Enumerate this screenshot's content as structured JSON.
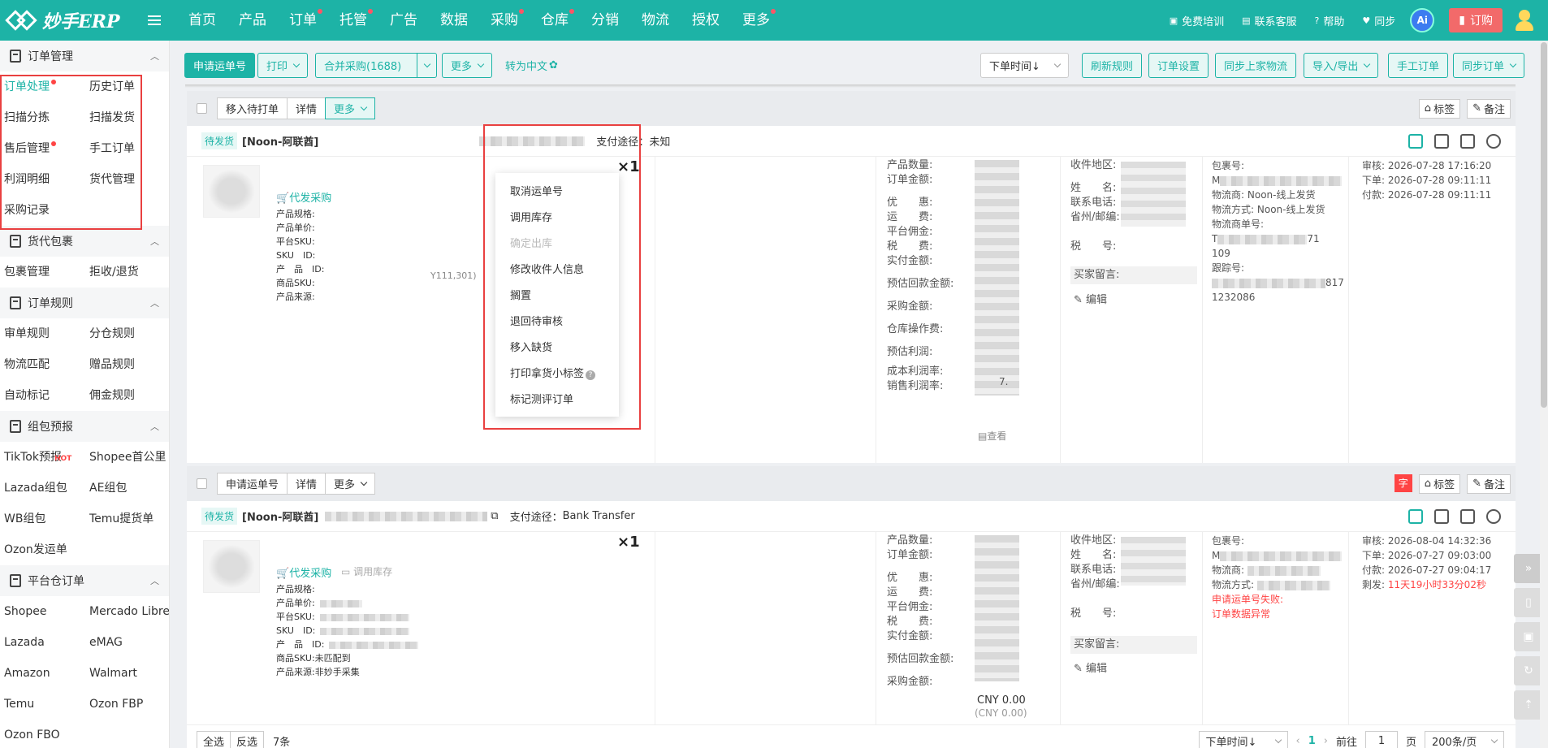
{
  "app": {
    "logo_text": "妙手ERP"
  },
  "topnav": {
    "items": [
      {
        "label": "首页",
        "dot": false
      },
      {
        "label": "产品",
        "dot": false
      },
      {
        "label": "订单",
        "dot": true
      },
      {
        "label": "托管",
        "dot": true
      },
      {
        "label": "广告",
        "dot": false
      },
      {
        "label": "数据",
        "dot": false
      },
      {
        "label": "采购",
        "dot": true
      },
      {
        "label": "仓库",
        "dot": true
      },
      {
        "label": "分销",
        "dot": false
      },
      {
        "label": "物流",
        "dot": false
      },
      {
        "label": "授权",
        "dot": false
      },
      {
        "label": "更多",
        "dot": true
      }
    ],
    "right": {
      "training": "免费培训",
      "service": "联系客服",
      "help": "帮助",
      "sync": "同步",
      "ai": "Ai",
      "order": "订购"
    }
  },
  "sidebar": {
    "sections": [
      {
        "title": "订单管理",
        "items": [
          "订单处理",
          "历史订单",
          "扫描分拣",
          "扫描发货",
          "售后管理",
          "手工订单",
          "利润明细",
          "货代管理",
          "采购记录"
        ]
      },
      {
        "title": "货代包裹",
        "items": [
          "包裹管理",
          "拒收/退货"
        ]
      },
      {
        "title": "订单规则",
        "items": [
          "审单规则",
          "分仓规则",
          "物流匹配",
          "赠品规则",
          "自动标记",
          "佣金规则"
        ]
      },
      {
        "title": "组包预报",
        "items": [
          "TikTok预报",
          "Shopee首公里",
          "Lazada组包",
          "AE组包",
          "WB组包",
          "Temu提货单",
          "Ozon发运单"
        ]
      },
      {
        "title": "平台仓订单",
        "items": [
          "Shopee",
          "Mercado Libre",
          "Lazada",
          "eMAG",
          "Amazon",
          "Walmart",
          "Temu",
          "Ozon FBP",
          "Ozon FBO"
        ]
      }
    ],
    "hot_badge": "HOT"
  },
  "toolbar": {
    "apply_waybill": "申请运单号",
    "print": "打印",
    "merge_purchase": "合并采购(1688)",
    "more": "更多",
    "to_chinese": "转为中文",
    "sort": "下单时间↓",
    "refresh_rules": "刷新规则",
    "order_settings": "订单设置",
    "sync_logistics": "同步上家物流",
    "import_export": "导入/导出",
    "manual_order": "手工订单",
    "sync_orders": "同步订单"
  },
  "order1": {
    "btn_move": "移入待打单",
    "btn_detail": "详情",
    "btn_more": "更多",
    "tag": "标签",
    "note": "备注",
    "status": "待发货",
    "shop": "[Noon-阿联酋]",
    "pay_label": "支付途径：",
    "pay_value": "未知",
    "qty": "×1",
    "purchase": "代发采购",
    "product_labels": [
      "产品规格:",
      "产品单价:",
      "平台SKU:",
      "SKU　ID:",
      "产　品　ID:",
      "商品SKU:",
      "产品来源:"
    ],
    "sku_tail": "Y111,301)",
    "fin_labels": [
      "产品数量:",
      "订单金额:",
      "优　　惠:",
      "运　　费:",
      "平台佣金:",
      "税　　费:",
      "实付金额:",
      "预估回款金额:",
      "采购金额:",
      "仓库操作费:",
      "预估利润:",
      "成本利润率:",
      "销售利润率:"
    ],
    "fin_tail": "7.",
    "view": "查看",
    "rcv_labels": [
      "收件地区:",
      "姓　　名:",
      "联系电话:",
      "省州/邮编:",
      "税　　号:"
    ],
    "buyer_msg": "买家留言:",
    "edit": "编辑",
    "pkg": {
      "pkg_no": "包裹号:",
      "prefix_m": "M",
      "carrier_label": "物流商:",
      "carrier": "Noon-线上发货",
      "method_label": "物流方式:",
      "method": "Noon-线上发货",
      "track_label": "物流商单号:",
      "track_a": "71",
      "track_b": "109",
      "track_c": "跟踪号:",
      "track_d": "817",
      "track_e": "1232086"
    },
    "times": {
      "audit": "审核: 2026-07-28 17:16:20",
      "order": "下单: 2026-07-28 09:11:11",
      "paid": "付款: 2026-07-28 09:11:11"
    }
  },
  "dropdown": {
    "items": [
      {
        "label": "取消运单号",
        "disabled": false
      },
      {
        "label": "调用库存",
        "disabled": false
      },
      {
        "label": "确定出库",
        "disabled": true
      },
      {
        "label": "修改收件人信息",
        "disabled": false
      },
      {
        "label": "搁置",
        "disabled": false
      },
      {
        "label": "退回待审核",
        "disabled": false
      },
      {
        "label": "移入缺货",
        "disabled": false
      },
      {
        "label": "打印拿货小标签",
        "disabled": false
      },
      {
        "label": "标记测评订单",
        "disabled": false
      }
    ]
  },
  "order2": {
    "btn_apply": "申请运单号",
    "btn_detail": "详情",
    "btn_more": "更多",
    "zi": "字",
    "tag": "标签",
    "note": "备注",
    "status": "待发货",
    "shop": "[Noon-阿联酋]",
    "pay_label": "支付途径：",
    "pay_value": "Bank Transfer",
    "qty": "×1",
    "purchase": "代发采购",
    "stock": "调用库存",
    "product_labels": [
      "产品规格:",
      "产品单价:",
      "平台SKU:",
      "SKU　ID:",
      "产　品　ID:",
      "商品SKU:",
      "产品来源:"
    ],
    "sku_value": "未匹配到",
    "source_value": "非妙手采集",
    "fin_labels": [
      "产品数量:",
      "订单金额:",
      "优　　惠:",
      "运　　费:",
      "平台佣金:",
      "税　　费:",
      "实付金额:",
      "预估回款金额:",
      "采购金额:"
    ],
    "purchase_amount": "CNY 0.00",
    "purchase_amount2": "(CNY 0.00)",
    "rcv_labels": [
      "收件地区:",
      "姓　　名:",
      "联系电话:",
      "省州/邮编:",
      "税　　号:"
    ],
    "buyer_msg": "买家留言:",
    "edit": "编辑",
    "pkg": {
      "pkg_no": "包裹号:",
      "prefix_m": "M",
      "carrier_label": "物流商:",
      "method_label": "物流方式:",
      "fail": "申请运单号失败:",
      "fail_reason": "订单数据异常"
    },
    "times": {
      "audit": "审核: 2026-08-04 14:32:36",
      "order": "下单: 2026-07-27 09:03:00",
      "paid": "付款: 2026-07-27 09:04:17",
      "remain_label": "剩发:",
      "remain": "11天19小时33分02秒"
    }
  },
  "bottom": {
    "select_all": "全选",
    "invert": "反选",
    "count": "7条",
    "sort": "下单时间↓",
    "page": "1",
    "goto": "前往",
    "goto_val": "1",
    "page_unit": "页",
    "per_page": "200条/页"
  }
}
